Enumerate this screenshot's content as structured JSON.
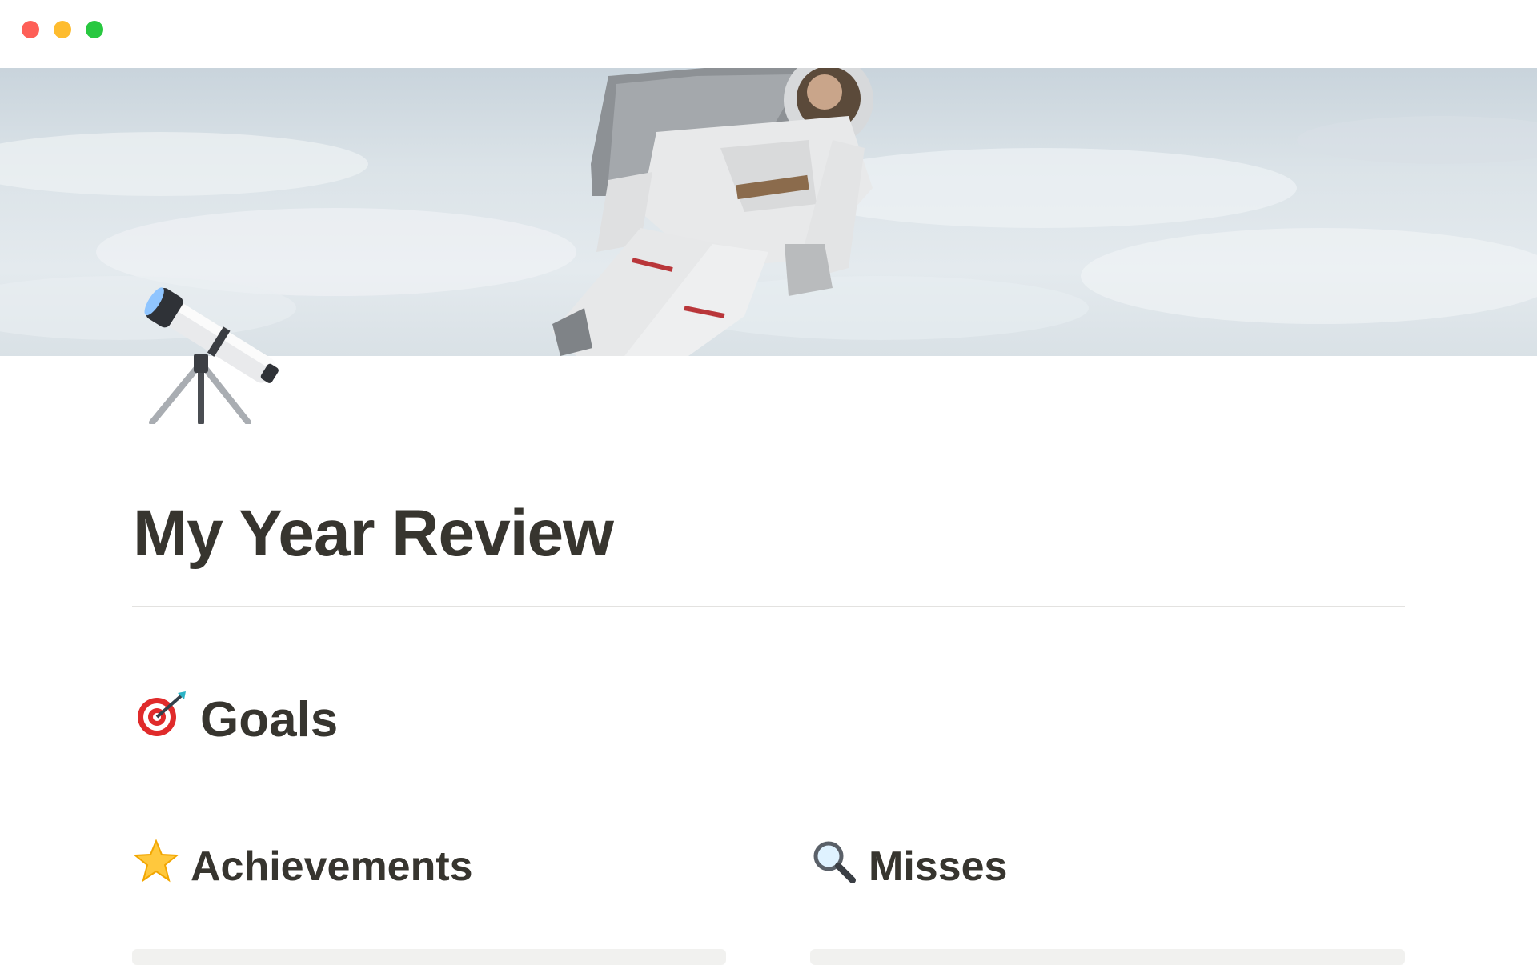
{
  "window": {
    "controls": [
      "close",
      "minimize",
      "maximize"
    ]
  },
  "cover": {
    "image": "astronaut-over-earth-clouds"
  },
  "page": {
    "icon": "telescope-icon",
    "title": "My Year Review"
  },
  "sections": {
    "goals": {
      "icon": "target-icon",
      "label": "Goals"
    },
    "achievements": {
      "icon": "star-icon",
      "label": "Achievements"
    },
    "misses": {
      "icon": "magnifying-glass-icon",
      "label": "Misses"
    }
  },
  "colors": {
    "text": "#37352f",
    "divider": "#e3e2e0",
    "card": "#f1f1ef",
    "close": "#fe5f57",
    "minimize": "#febc2e",
    "maximize": "#28c840"
  }
}
